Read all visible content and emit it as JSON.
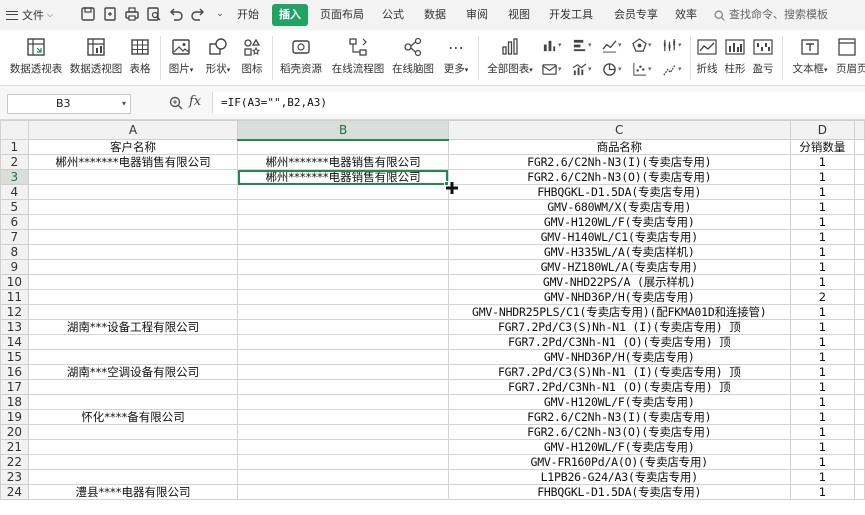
{
  "menu": {
    "file_label": "文件",
    "tabs": [
      "开始",
      "插入",
      "页面布局",
      "公式",
      "数据",
      "审阅",
      "视图",
      "开发工具",
      "会员专享",
      "效率"
    ],
    "active_tab": "插入",
    "search_placeholder": "查找命令、搜索模板"
  },
  "ribbon": {
    "pivot_table": "数据透视表",
    "pivot_chart": "数据透视图",
    "table": "表格",
    "picture": "图片",
    "shape": "形状",
    "icon": "图标",
    "resources": "稻壳资源",
    "flowchart": "在线流程图",
    "mindmap": "在线脑图",
    "more": "更多",
    "all_charts": "全部图表",
    "line": "折线",
    "column": "柱形",
    "winloss": "盈亏",
    "textbox": "文本框",
    "header_footer": "页眉页"
  },
  "formula_bar": {
    "cell_ref": "B3",
    "fx": "fx",
    "formula": "=IF(A3=\"\",B2,A3)"
  },
  "sheet": {
    "columns": [
      "A",
      "B",
      "C",
      "D"
    ],
    "selected_column": "B",
    "selected_row": 3,
    "rows": [
      {
        "n": 1,
        "a": "客户名称",
        "b": "",
        "c": "商品名称",
        "d": "分销数量"
      },
      {
        "n": 2,
        "a": "郴州*******电器销售有限公司",
        "b": "郴州*******电器销售有限公司",
        "c": "FGR2.6/C2Nh-N3(I)(专卖店专用)",
        "d": "1"
      },
      {
        "n": 3,
        "a": "",
        "b": "郴州*******电器销售有限公司",
        "c": "FGR2.6/C2Nh-N3(O)(专卖店专用)",
        "d": "1"
      },
      {
        "n": 4,
        "a": "",
        "b": "",
        "c": "FHBQGKL-D1.5DA(专卖店专用)",
        "d": "1"
      },
      {
        "n": 5,
        "a": "",
        "b": "",
        "c": "GMV-680WM/X(专卖店专用)",
        "d": "1"
      },
      {
        "n": 6,
        "a": "",
        "b": "",
        "c": "GMV-H120WL/F(专卖店专用)",
        "d": "1"
      },
      {
        "n": 7,
        "a": "",
        "b": "",
        "c": "GMV-H140WL/C1(专卖店专用)",
        "d": "1"
      },
      {
        "n": 8,
        "a": "",
        "b": "",
        "c": "GMV-H335WL/A(专卖店样机)",
        "d": "1"
      },
      {
        "n": 9,
        "a": "",
        "b": "",
        "c": "GMV-HZ180WL/A(专卖店专用)",
        "d": "1"
      },
      {
        "n": 10,
        "a": "",
        "b": "",
        "c": "GMV-NHD22PS/A (展示样机)",
        "d": "1"
      },
      {
        "n": 11,
        "a": "",
        "b": "",
        "c": "GMV-NHD36P/H(专卖店专用)",
        "d": "2"
      },
      {
        "n": 12,
        "a": "",
        "b": "",
        "c": "GMV-NHDR25PLS/C1(专卖店专用)(配FKMA01D和连接管)",
        "d": "1"
      },
      {
        "n": 13,
        "a": "湖南***设备工程有限公司",
        "b": "",
        "c": "FGR7.2Pd/C3(S)Nh-N1 (I)(专卖店专用) 顶",
        "d": "1"
      },
      {
        "n": 14,
        "a": "",
        "b": "",
        "c": "FGR7.2Pd/C3Nh-N1 (O)(专卖店专用) 顶",
        "d": "1"
      },
      {
        "n": 15,
        "a": "",
        "b": "",
        "c": "GMV-NHD36P/H(专卖店专用)",
        "d": "1"
      },
      {
        "n": 16,
        "a": "湖南***空调设备有限公司",
        "b": "",
        "c": "FGR7.2Pd/C3(S)Nh-N1 (I)(专卖店专用) 顶",
        "d": "1"
      },
      {
        "n": 17,
        "a": "",
        "b": "",
        "c": "FGR7.2Pd/C3Nh-N1 (O)(专卖店专用) 顶",
        "d": "1"
      },
      {
        "n": 18,
        "a": "",
        "b": "",
        "c": "GMV-H120WL/F(专卖店专用)",
        "d": "1"
      },
      {
        "n": 19,
        "a": "怀化****备有限公司",
        "b": "",
        "c": "FGR2.6/C2Nh-N3(I)(专卖店专用)",
        "d": "1"
      },
      {
        "n": 20,
        "a": "",
        "b": "",
        "c": "FGR2.6/C2Nh-N3(O)(专卖店专用)",
        "d": "1"
      },
      {
        "n": 21,
        "a": "",
        "b": "",
        "c": "GMV-H120WL/F(专卖店专用)",
        "d": "1"
      },
      {
        "n": 22,
        "a": "",
        "b": "",
        "c": "GMV-FR160Pd/A(O)(专卖店专用)",
        "d": "1"
      },
      {
        "n": 23,
        "a": "",
        "b": "",
        "c": "L1PB26-G24/A3(专卖店专用)",
        "d": "1"
      },
      {
        "n": 24,
        "a": "澧县****电器有限公司",
        "b": "",
        "c": "FHBQGKL-D1.5DA(专卖店专用)",
        "d": "1"
      }
    ]
  }
}
